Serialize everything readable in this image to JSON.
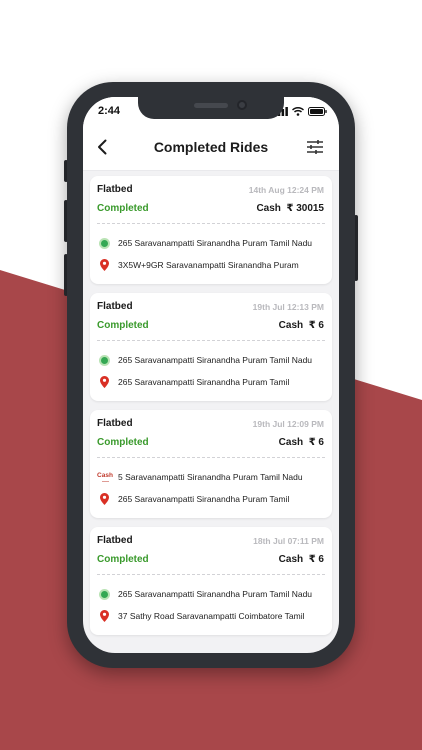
{
  "status_bar": {
    "time": "2:44"
  },
  "header": {
    "title": "Completed Rides"
  },
  "icons": {
    "back": "chevron-left-icon",
    "filter": "sliders-icon",
    "pickup": "green-dot-icon",
    "drop": "map-pin-icon"
  },
  "colors": {
    "accent_red": "#a8474a",
    "completed_green": "#3a9a2c",
    "pin_red": "#d93025",
    "dot_green": "#34a853"
  },
  "rides": [
    {
      "vehicle": "Flatbed",
      "date": "14th Aug 12:24 PM",
      "status": "Completed",
      "payment_method": "Cash",
      "amount": "₹ 30015",
      "pickup": "265  Saravanampatti Siranandha Puram Tamil Nadu",
      "drop": "3X5W+9GR  Saravanampatti Siranandha Puram"
    },
    {
      "vehicle": "Flatbed",
      "date": "19th Jul 12:13 PM",
      "status": "Completed",
      "payment_method": "Cash",
      "amount": "₹ 6",
      "pickup": "265  Saravanampatti Siranandha Puram Tamil Nadu",
      "drop": "265  Saravanampatti Siranandha Puram Tamil"
    },
    {
      "vehicle": "Flatbed",
      "date": "19th Jul 12:09 PM",
      "status": "Completed",
      "payment_method": "Cash",
      "amount": "₹ 6",
      "overlay_label": "Cash",
      "pickup": "5  Saravanampatti Siranandha Puram Tamil Nadu",
      "drop": "265  Saravanampatti Siranandha Puram Tamil"
    },
    {
      "vehicle": "Flatbed",
      "date": "18th Jul 07:11 PM",
      "status": "Completed",
      "payment_method": "Cash",
      "amount": "₹ 6",
      "pickup": "265  Saravanampatti Siranandha Puram Tamil Nadu",
      "drop": "37 Sathy Road Saravanampatti Coimbatore Tamil"
    }
  ]
}
